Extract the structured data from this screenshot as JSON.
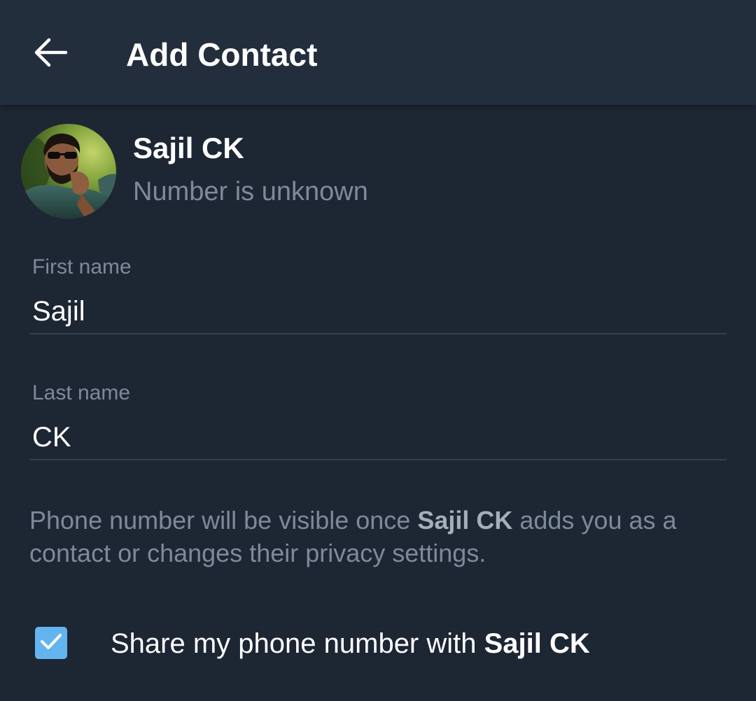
{
  "app_bar": {
    "title": "Add Contact",
    "back_icon": "arrow-left-icon"
  },
  "profile": {
    "name": "Sajil CK",
    "status": "Number is unknown",
    "avatar": "user-avatar-photo"
  },
  "form": {
    "first_name_label": "First name",
    "first_name_value": "Sajil",
    "last_name_label": "Last name",
    "last_name_value": "CK"
  },
  "info": {
    "text_before": "Phone number will be visible once ",
    "name": "Sajil CK",
    "text_after": " adds you as a contact or changes their privacy settings."
  },
  "share": {
    "checked": true,
    "check_icon": "checkmark-icon",
    "label_before": "Share my phone number with ",
    "name": "Sajil CK"
  },
  "colors": {
    "background": "#1d2633",
    "app_bar": "#232e3c",
    "accent": "#64b5ef",
    "secondary_text": "#7d8b99",
    "primary_text": "#ffffff",
    "divider": "#35404d"
  }
}
